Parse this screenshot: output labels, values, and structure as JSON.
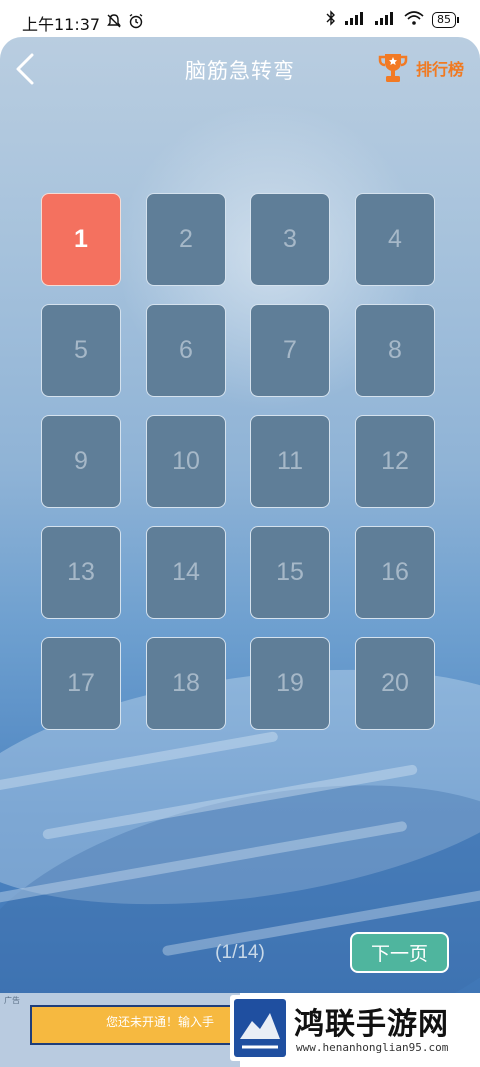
{
  "status_bar": {
    "time": "上午11:37",
    "battery": "85"
  },
  "header": {
    "title": "脑筋急转弯",
    "leaderboard_label": "排行榜"
  },
  "levels": [
    "1",
    "2",
    "3",
    "4",
    "5",
    "6",
    "7",
    "8",
    "9",
    "10",
    "11",
    "12",
    "13",
    "14",
    "15",
    "16",
    "17",
    "18",
    "19",
    "20"
  ],
  "active_level": "1",
  "pagination": {
    "indicator": "(1/14)",
    "next_label": "下一页"
  },
  "ad": {
    "tag": "广告",
    "text": "您还未开通！输入手"
  },
  "watermark": {
    "title": "鸿联手游网",
    "url": "www.henanhonglian95.com"
  },
  "colors": {
    "active_tile": "#f4715f",
    "tile": "#5f7e98",
    "next_button": "#4fb59e",
    "leaderboard": "#f07a22"
  }
}
